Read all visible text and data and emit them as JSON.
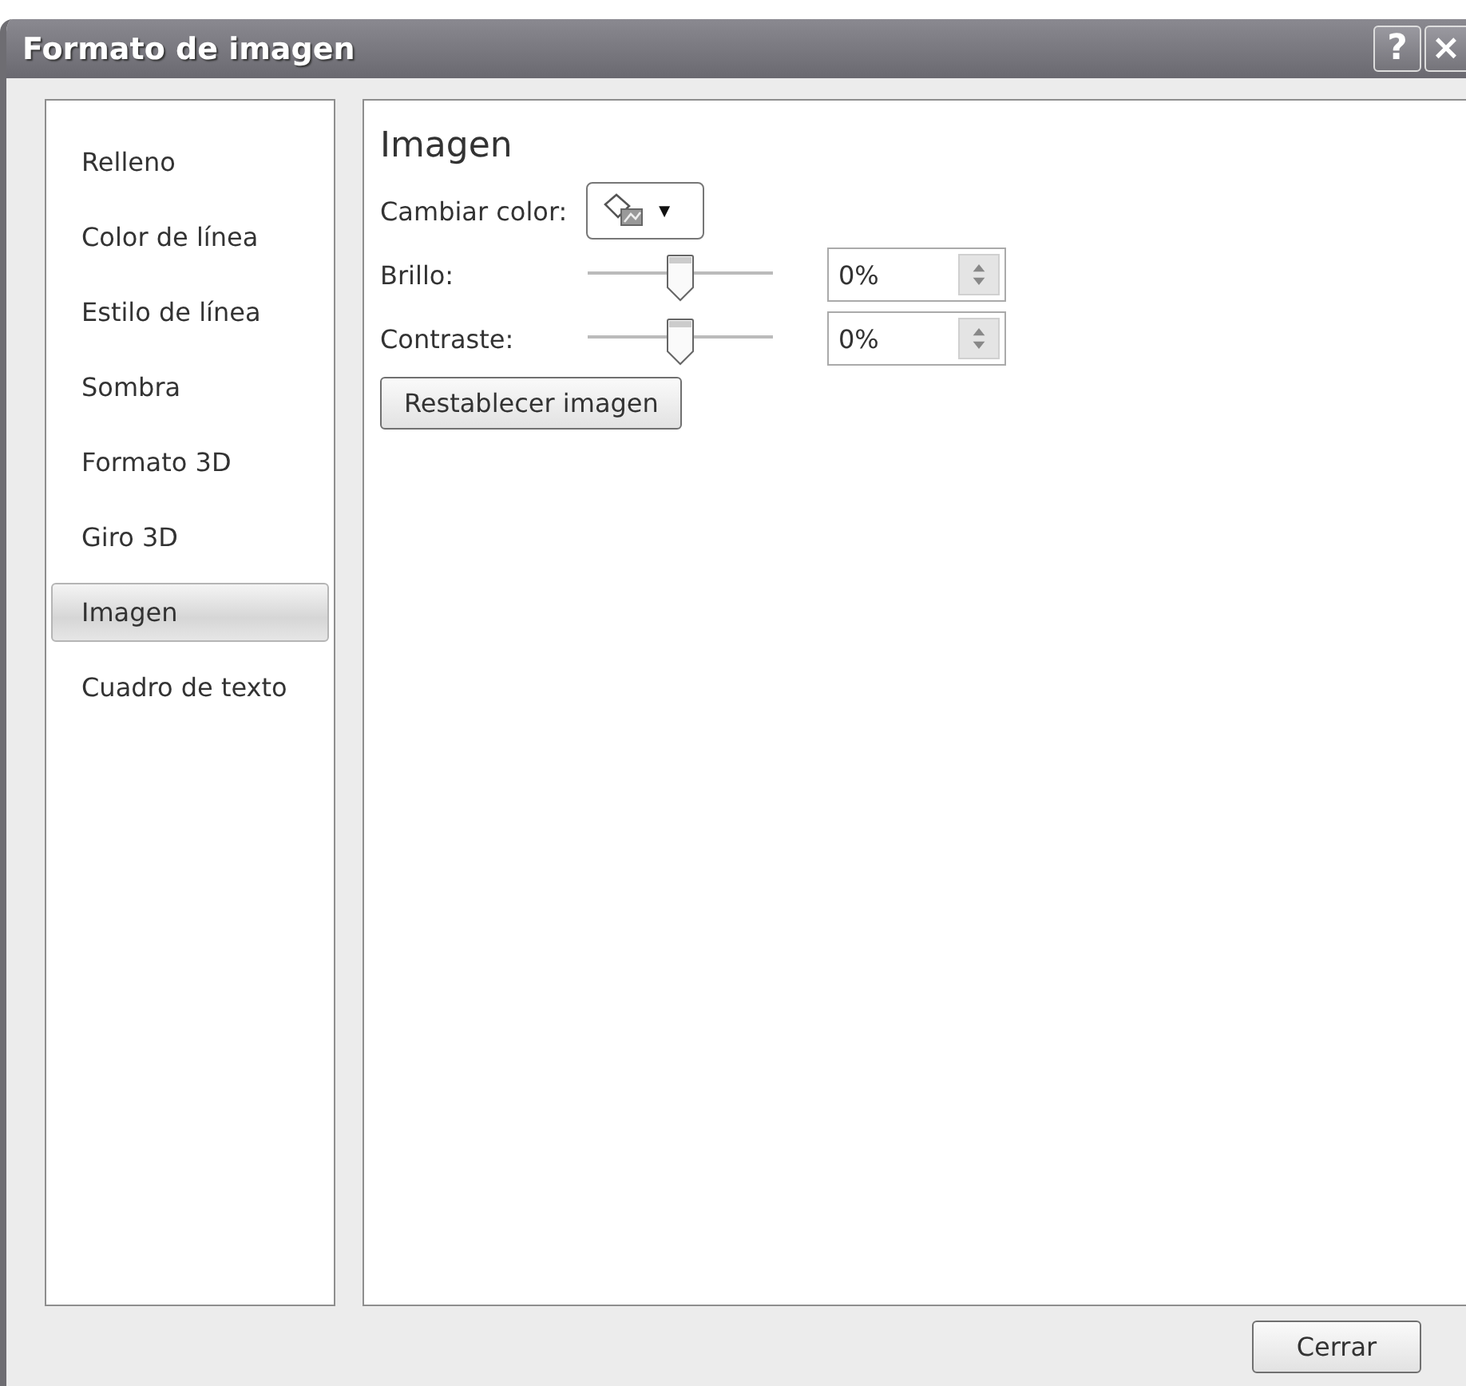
{
  "window": {
    "title": "Formato de imagen",
    "buttons": [
      {
        "kind": "help",
        "label": "?"
      },
      {
        "kind": "close",
        "label": "×"
      }
    ]
  },
  "sidebar": {
    "items": [
      {
        "label": "Relleno",
        "selected": false
      },
      {
        "label": "Color de línea",
        "selected": false
      },
      {
        "label": "Estilo de línea",
        "selected": false
      },
      {
        "label": "Sombra",
        "selected": false
      },
      {
        "label": "Formato 3D",
        "selected": false
      },
      {
        "label": "Giro 3D",
        "selected": false
      },
      {
        "label": "Imagen",
        "selected": true
      },
      {
        "label": "Cuadro de texto",
        "selected": false
      }
    ]
  },
  "panel": {
    "heading": "Imagen",
    "recolor": {
      "label": "Cambiar color:",
      "caret": "▼"
    },
    "sliders": [
      {
        "label": "Brillo:",
        "level": 0.5,
        "value": "0%"
      },
      {
        "label": "Contraste:",
        "level": 0.5,
        "value": "0%"
      }
    ],
    "reset_button": "Restablecer imagen"
  },
  "footer": {
    "close_button": "Cerrar"
  }
}
